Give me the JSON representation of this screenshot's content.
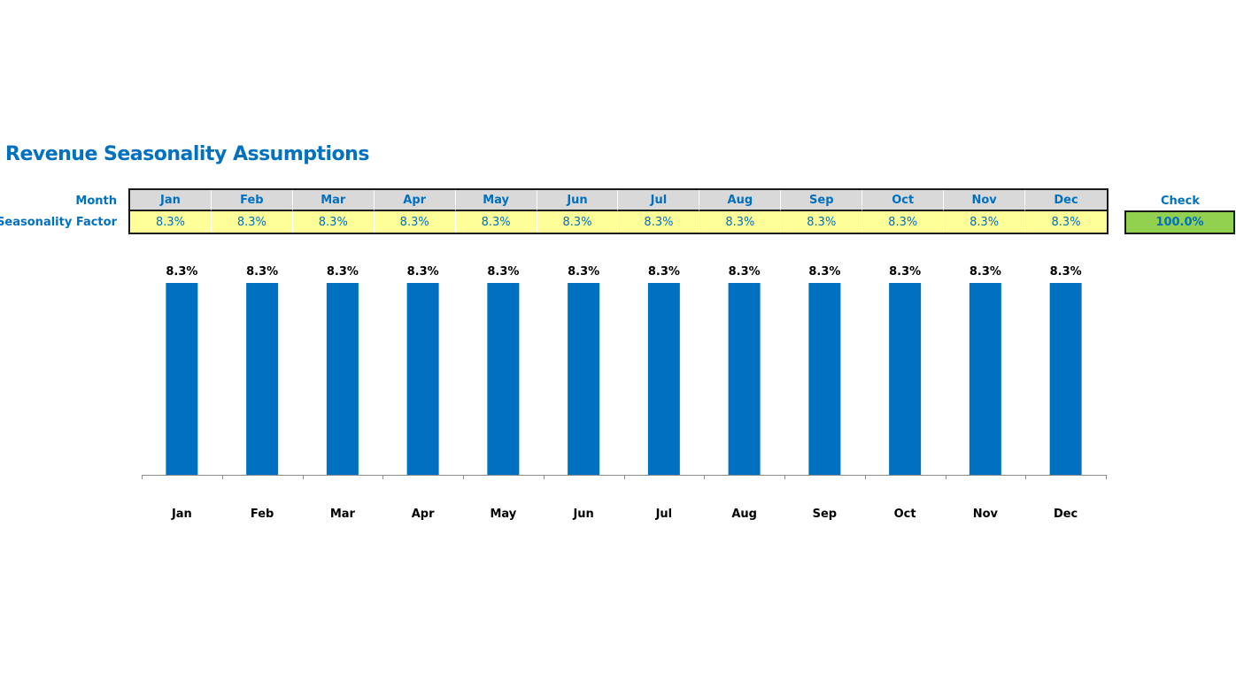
{
  "title": "Revenue Seasonality Assumptions",
  "table": {
    "row_labels": {
      "month": "Month",
      "factor": "Seasonality Factor"
    },
    "months": [
      "Jan",
      "Feb",
      "Mar",
      "Apr",
      "May",
      "Jun",
      "Jul",
      "Aug",
      "Sep",
      "Oct",
      "Nov",
      "Dec"
    ],
    "factors": [
      "8.3%",
      "8.3%",
      "8.3%",
      "8.3%",
      "8.3%",
      "8.3%",
      "8.3%",
      "8.3%",
      "8.3%",
      "8.3%",
      "8.3%",
      "8.3%"
    ]
  },
  "check": {
    "label": "Check",
    "value": "100.0%"
  },
  "colors": {
    "accent": "#0070c0",
    "bar": "#0070c0",
    "header_bg": "#d9d9d9",
    "input_bg": "#ffff99",
    "check_bg": "#92d050"
  },
  "chart_data": {
    "type": "bar",
    "title": "",
    "xlabel": "",
    "ylabel": "",
    "categories": [
      "Jan",
      "Feb",
      "Mar",
      "Apr",
      "May",
      "Jun",
      "Jul",
      "Aug",
      "Sep",
      "Oct",
      "Nov",
      "Dec"
    ],
    "values": [
      8.3,
      8.3,
      8.3,
      8.3,
      8.3,
      8.3,
      8.3,
      8.3,
      8.3,
      8.3,
      8.3,
      8.3
    ],
    "data_labels": [
      "8.3%",
      "8.3%",
      "8.3%",
      "8.3%",
      "8.3%",
      "8.3%",
      "8.3%",
      "8.3%",
      "8.3%",
      "8.3%",
      "8.3%",
      "8.3%"
    ],
    "ylim": [
      0,
      8.3
    ],
    "grid": false,
    "legend": "none",
    "y_axis_visible": false
  }
}
